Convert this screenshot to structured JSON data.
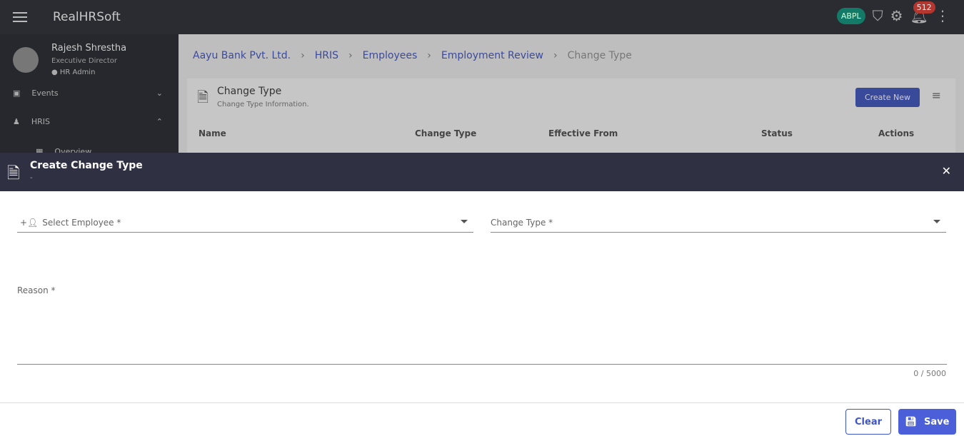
{
  "app": {
    "title": "RealHRSoft",
    "org_badge": "ABPL",
    "notification_count": "512"
  },
  "user": {
    "name": "Rajesh Shrestha",
    "role": "Executive Director",
    "group": "HR Admin"
  },
  "sidebar": {
    "items": [
      {
        "label": "Events"
      },
      {
        "label": "HRIS"
      },
      {
        "label": "Overview"
      }
    ]
  },
  "breadcrumb": [
    "Aayu Bank Pvt. Ltd.",
    "HRIS",
    "Employees",
    "Employment Review",
    "Change Type"
  ],
  "card": {
    "title": "Change Type",
    "subtitle": "Change Type Information.",
    "create_label": "Create New",
    "columns": [
      "Name",
      "Change Type",
      "Effective From",
      "Status",
      "Actions"
    ]
  },
  "dialog": {
    "title": "Create Change Type",
    "subtitle": "-",
    "employee_placeholder": "Select Employee *",
    "change_type_placeholder": "Change Type *",
    "reason_label": "Reason *",
    "char_count": "0 / 5000",
    "clear_label": "Clear",
    "save_label": "Save"
  }
}
